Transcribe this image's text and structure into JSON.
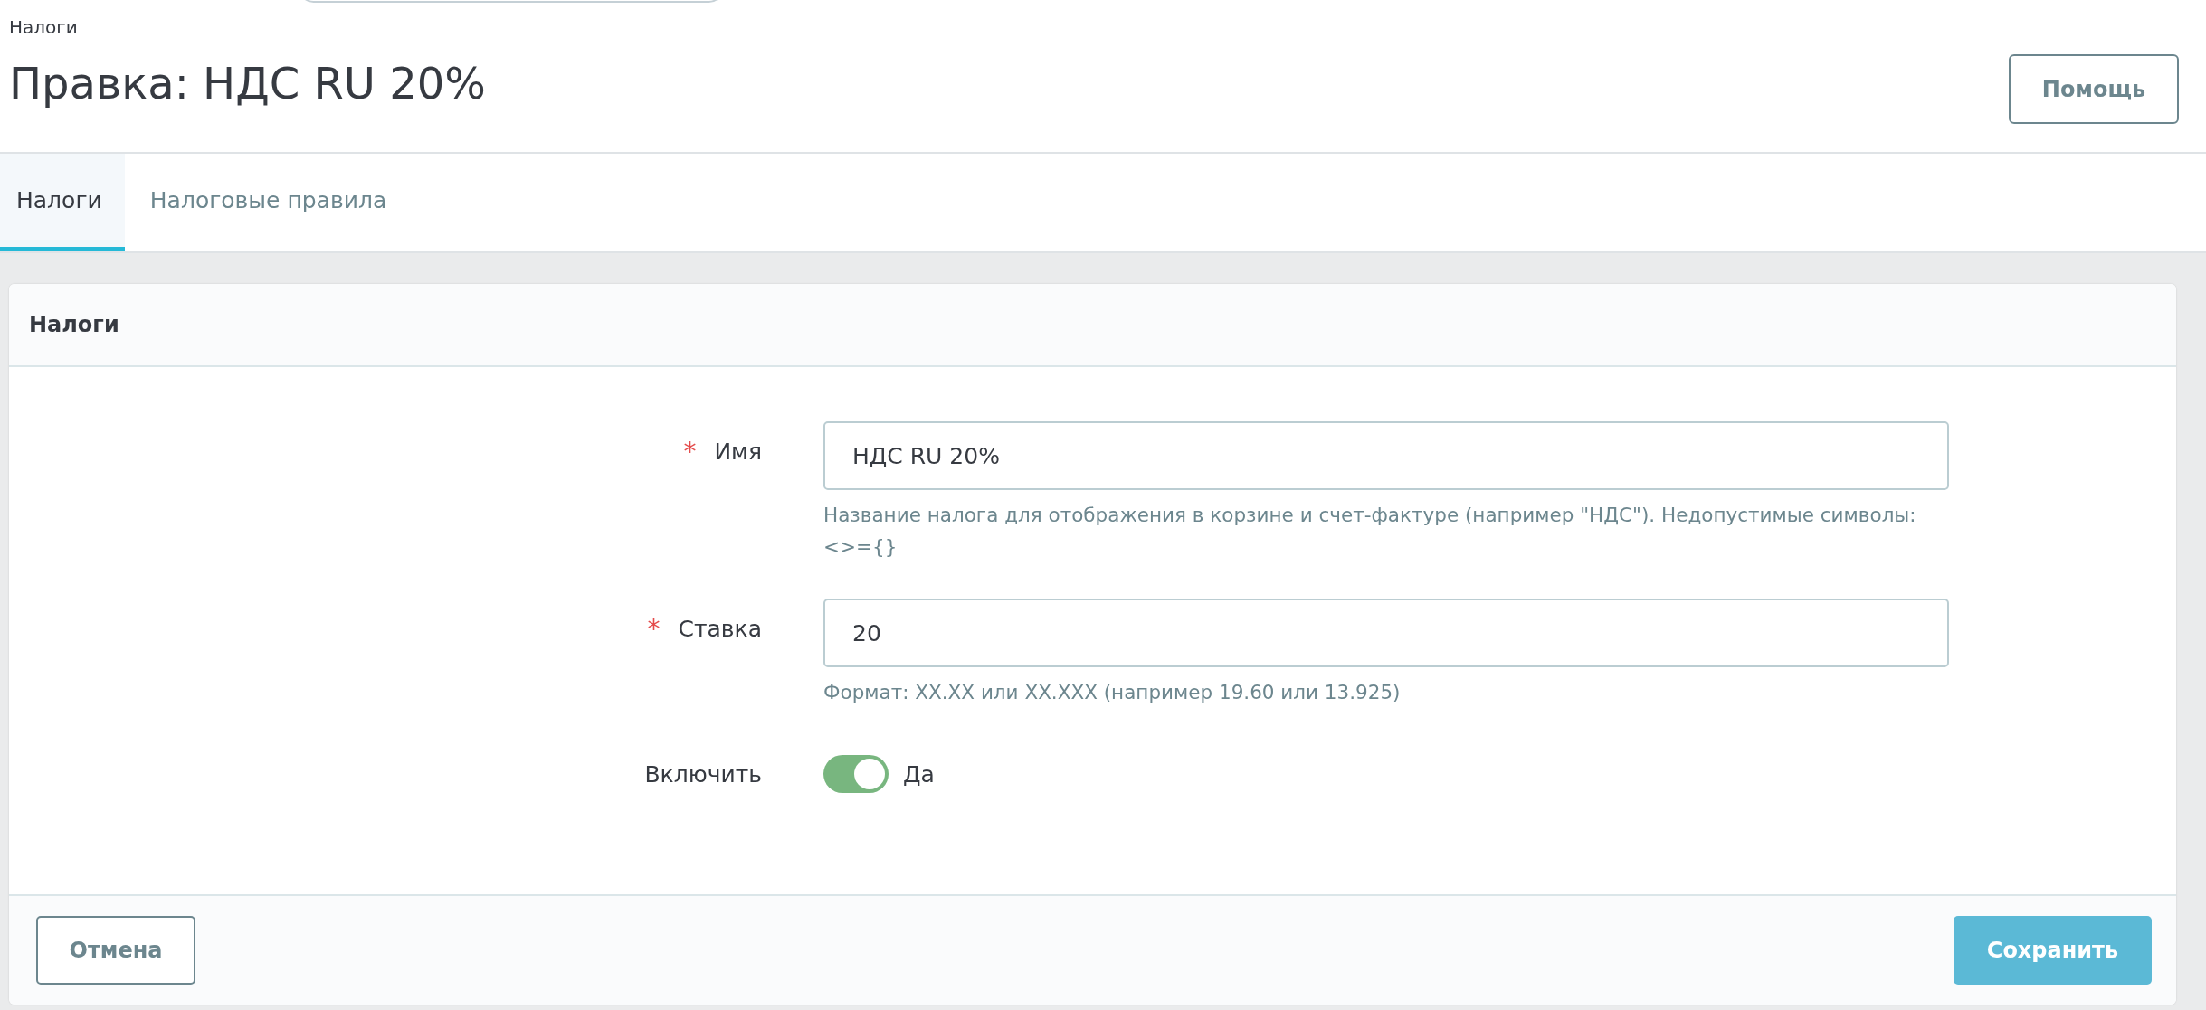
{
  "breadcrumb": "Налоги",
  "title": "Правка: НДС RU 20%",
  "help_button": "Помощь",
  "tabs": [
    {
      "label": "Налоги",
      "selected": true
    },
    {
      "label": "Налоговые правила",
      "selected": false
    }
  ],
  "card": {
    "title": "Налоги",
    "fields": [
      {
        "kind": "text",
        "label": "Имя",
        "required_mark": "*",
        "value": "НДС RU 20%",
        "help": "Название налога для отображения в корзине и счет-фактуре (например \"НДС\"). Недопустимые символы: <>={}"
      },
      {
        "kind": "text",
        "label": "Ставка",
        "required_mark": "*",
        "value": "20",
        "help": "Формат: XX.XX или XX.XXX (например 19.60 или 13.925)"
      },
      {
        "kind": "switch",
        "label": "Включить",
        "on": true,
        "state_label": "Да"
      }
    ],
    "cancel_button": "Отмена",
    "save_button": "Сохранить"
  }
}
